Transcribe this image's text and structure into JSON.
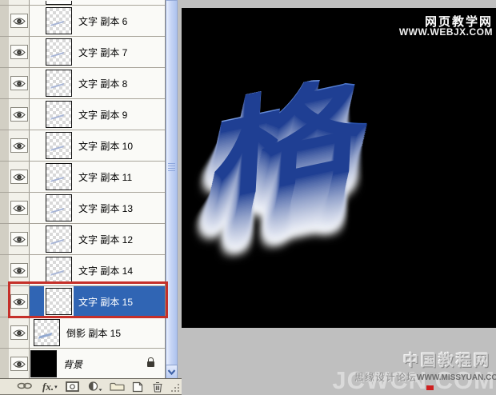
{
  "layers_panel": {
    "rows": [
      {
        "label": "",
        "kind": "partial",
        "visible": true
      },
      {
        "label": "文字 副本 6",
        "kind": "text",
        "visible": true
      },
      {
        "label": "文字 副本 7",
        "kind": "text",
        "visible": true
      },
      {
        "label": "文字 副本 8",
        "kind": "text",
        "visible": true
      },
      {
        "label": "文字 副本 9",
        "kind": "text",
        "visible": true
      },
      {
        "label": "文字 副本 10",
        "kind": "text",
        "visible": true
      },
      {
        "label": "文字 副本 11",
        "kind": "text",
        "visible": true
      },
      {
        "label": "文字 副本 13",
        "kind": "text",
        "visible": true
      },
      {
        "label": "文字 副本 12",
        "kind": "text",
        "visible": true
      },
      {
        "label": "文字 副本 14",
        "kind": "text",
        "visible": true
      },
      {
        "label": "文字 副本 15",
        "kind": "text",
        "visible": true,
        "selected": true,
        "red_highlight": true
      },
      {
        "label": "倒影 副本 15",
        "kind": "reflection",
        "visible": true
      },
      {
        "label": "背景",
        "kind": "background",
        "visible": true,
        "locked": true
      }
    ],
    "selected_color": "#3065b4",
    "highlight_color": "#c5302a",
    "footer": {
      "fx_label": "fx.",
      "icons": [
        "link-layers-icon",
        "layer-style-icon",
        "add-layer-mask-icon",
        "adjustment-layer-icon",
        "new-group-icon",
        "new-layer-icon",
        "delete-layer-icon"
      ]
    },
    "scrollbar": {
      "has_down_arrow": true
    }
  },
  "canvas": {
    "background": "#000000",
    "artwork": {
      "text": "格",
      "face_color": "#2f5cb8",
      "extrude_fade_to": "#ffffff"
    },
    "watermark_top": {
      "line1": "网页教学网",
      "line2": "WWW.WEBJX.COM"
    },
    "watermark_bottom": {
      "site_name": "中国教程网",
      "big_text": "JCWCN.COM",
      "forum": "思缘设计论坛",
      "url": "WWW.MISSYUAN.COM"
    }
  }
}
